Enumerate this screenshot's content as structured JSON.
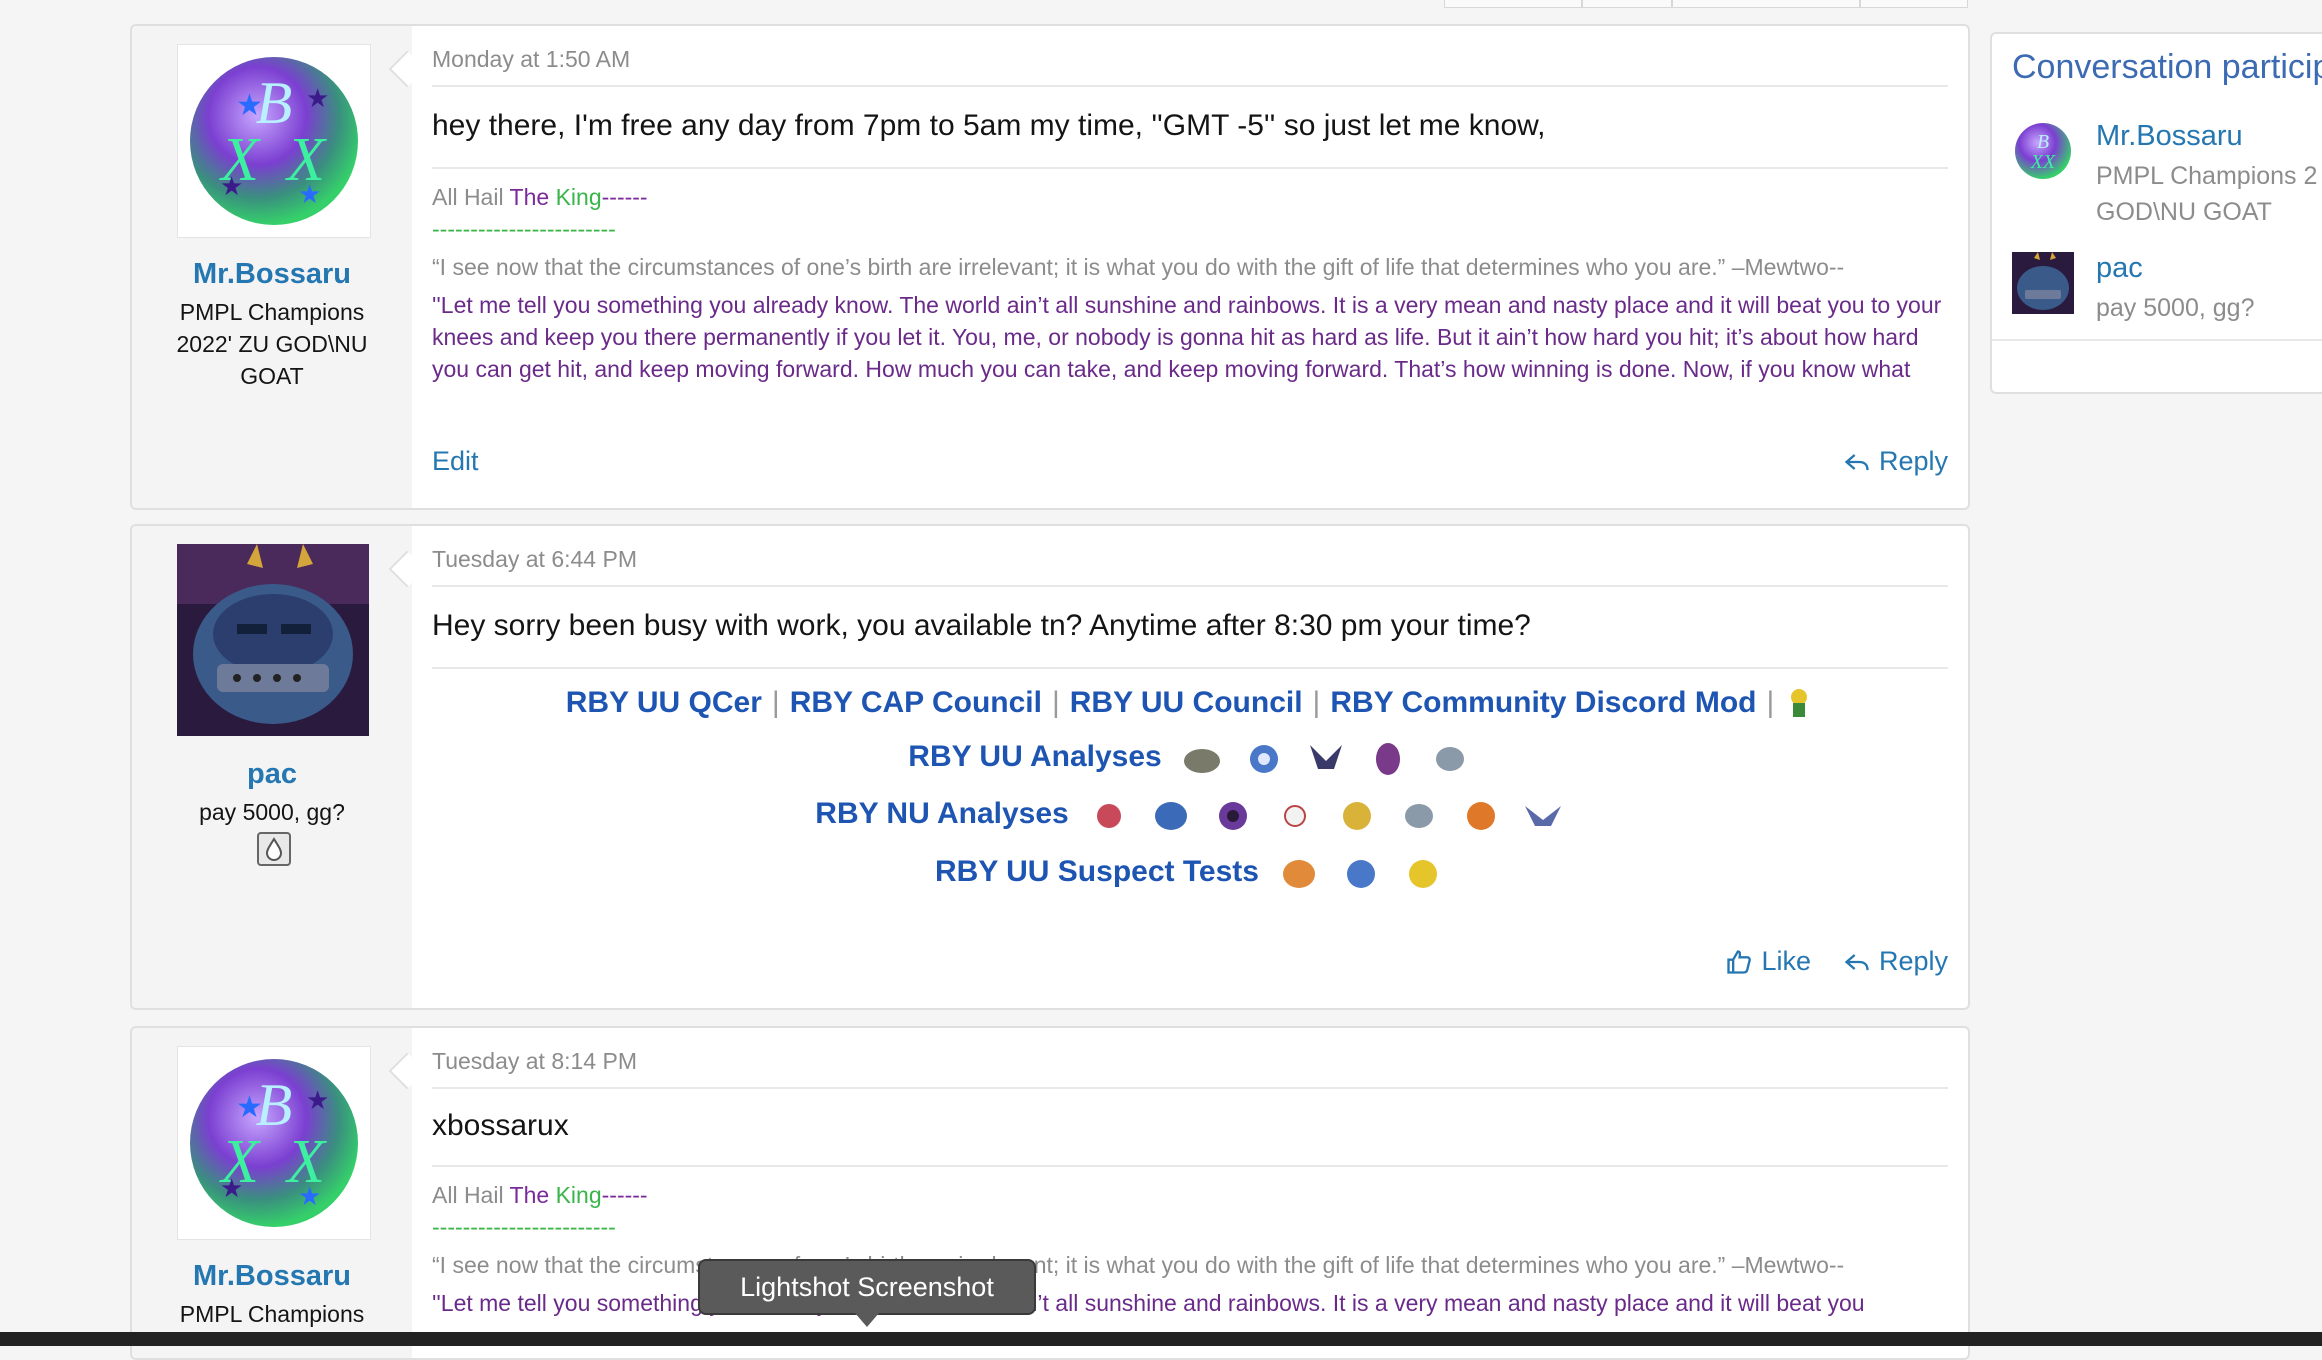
{
  "sidebar": {
    "title": "Conversation particip",
    "participants": [
      {
        "name": "Mr.Bossaru",
        "meta_line1": "PMPL Champions 2",
        "meta_line2": "GOD\\NU GOAT"
      },
      {
        "name": "pac",
        "meta_line1": "pay 5000, gg?"
      }
    ]
  },
  "posts": [
    {
      "username": "Mr.Bossaru",
      "user_title": "PMPL Champions 2022' ZU GOD\\NU GOAT",
      "date": "Monday at 1:50 AM",
      "body": "hey there, I'm free any day from 7pm to 5am my time, ''GMT -5'' so just let me know,",
      "sig_line1_a": "All Hail ",
      "sig_line1_b": "The",
      "sig_line1_c": " King",
      "sig_line1_d": "------",
      "sig_dashes": "------------------------",
      "sig_quote1": "“I see now that the circumstances of one’s birth are irrelevant; it is what you do with the gift of life that determines who you are.” –Mewtwo--",
      "sig_quote2": "''Let me tell you something you already know. The world ain’t all sunshine and rainbows. It is a very mean and nasty place and it will beat you to your knees and keep you there permanently if you let it. You, me, or nobody is gonna hit as hard as life. But it ain’t how hard you hit; it’s about how hard you can get hit, and keep moving forward. How much you can take, and keep moving forward. That’s how winning is done. Now, if you know what you’re worth, then go out and get what you’re worth. But you gotta be willing to take the hit, and not pointing fingers",
      "edit_label": "Edit",
      "reply_label": "Reply"
    },
    {
      "username": "pac",
      "user_title": "pay 5000, gg?",
      "date": "Tuesday at 6:44 PM",
      "body": "Hey sorry been busy with work, you available tn? Anytime after 8:30 pm your time?",
      "sig_links": [
        "RBY UU QCer",
        "RBY CAP Council",
        "RBY UU Council",
        "RBY Community Discord Mod"
      ],
      "sig_sep": "|",
      "sig_uu_analyses": "RBY UU Analyses",
      "sig_nu_analyses": "RBY NU Analyses",
      "sig_suspect": "RBY UU Suspect Tests",
      "like_label": "Like",
      "reply_label": "Reply"
    },
    {
      "username": "Mr.Bossaru",
      "user_title": "PMPL Champions",
      "date": "Tuesday at 8:14 PM",
      "body": "xbossarux",
      "sig_line1_a": "All Hail ",
      "sig_line1_b": "The",
      "sig_line1_c": " King",
      "sig_line1_d": "------",
      "sig_dashes": "------------------------",
      "sig_quote1": "“I see now that the circumstances of one’s birth are irrelevant; it is what you do with the gift of life that determines who you are.” –Mewtwo--",
      "sig_quote2": "''Let me tell you something you already know. The world ain’t all sunshine and rainbows. It is a very mean and nasty place and it will beat you"
    }
  ],
  "tooltip": "Lightshot Screenshot"
}
